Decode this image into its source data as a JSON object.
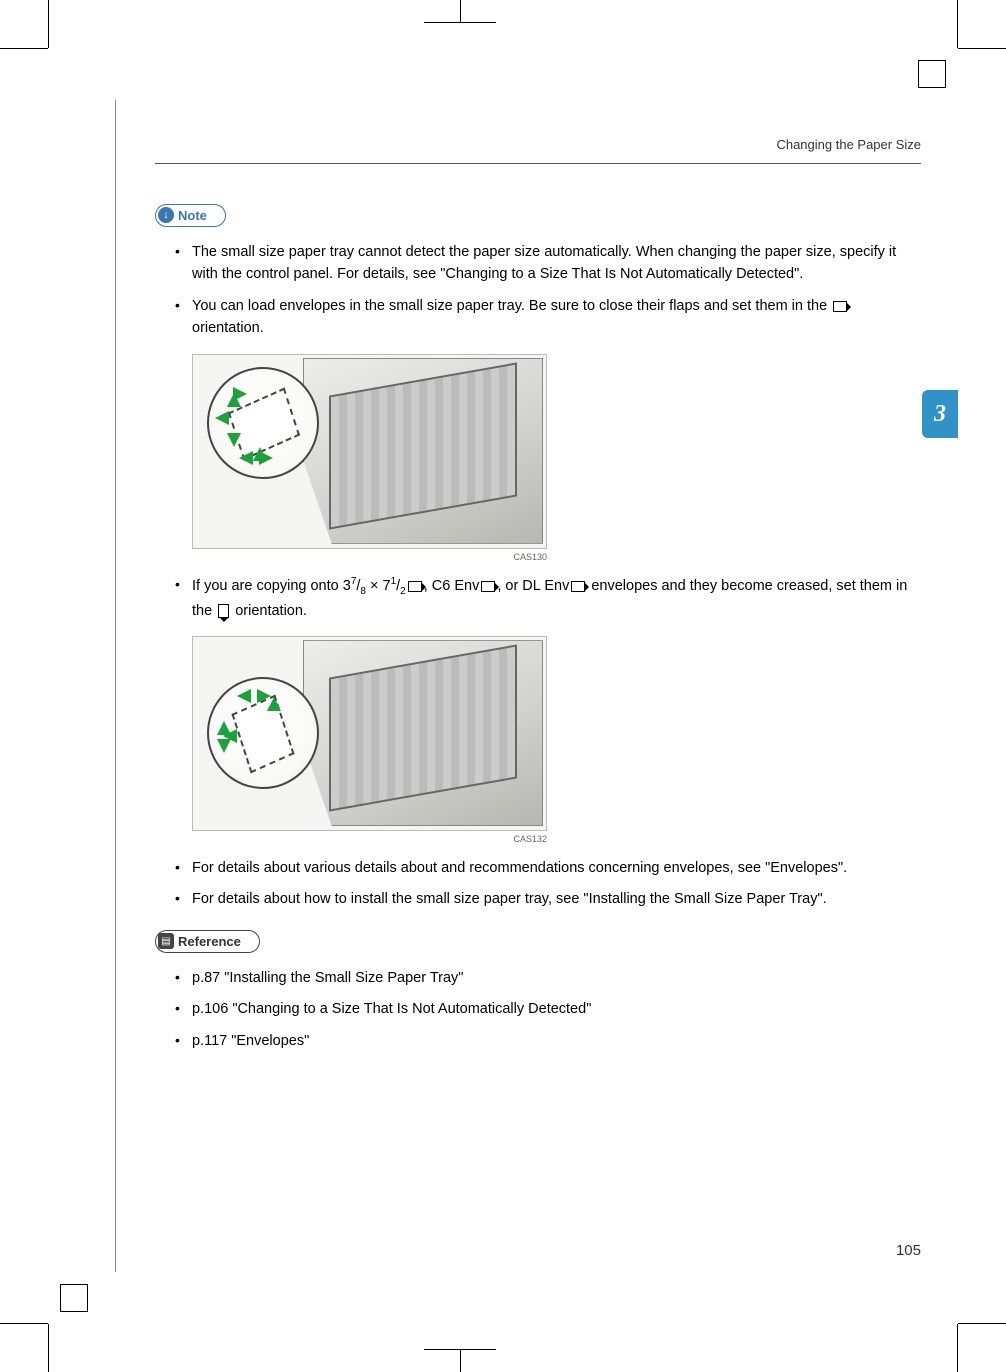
{
  "header": {
    "running_title": "Changing the Paper Size"
  },
  "chapter_tab": "3",
  "note_section": {
    "label": "Note",
    "items": [
      "The small size paper tray cannot detect the paper size automatically. When changing the paper size, specify it with the control panel. For details, see \"Changing to a Size That Is Not Automatically Detected\".",
      "You can load envelopes in the small size paper tray. Be sure to close their flaps and set them in the ~LANDSCAPE_FLAP~ orientation.",
      "If you are copying onto 3~FRAC78~ × 7~FRAC12~~LANDSCAPE_FLAP~, C6 Env~LANDSCAPE_FLAP~, or DL Env~LANDSCAPE_FLAP~ envelopes and they become creased, set them in the ~PORTRAIT_FLAP~ orientation.",
      "For details about various details about and recommendations concerning envelopes, see \"Envelopes\".",
      "For details about how to install the small size paper tray, see \"Installing the Small Size Paper Tray\"."
    ]
  },
  "figures": {
    "fig1_caption": "CAS130",
    "fig2_caption": "CAS132"
  },
  "reference_section": {
    "label": "Reference",
    "items": [
      "p.87 \"Installing the Small Size Paper Tray\"",
      "p.106 \"Changing to a Size That Is Not Automatically Detected\"",
      "p.117 \"Envelopes\""
    ]
  },
  "page_number": "105"
}
